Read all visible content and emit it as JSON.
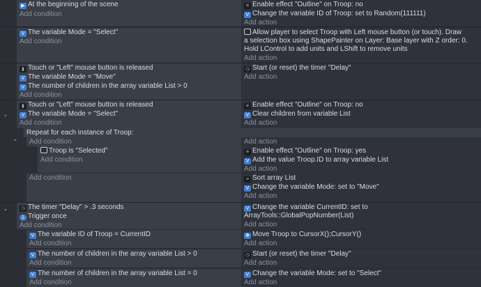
{
  "events": [
    {
      "conditions": [
        "At the beginning of the scene"
      ],
      "add_condition": "Add condition",
      "actions": [
        "Enable effect \"Outline\" on Troop: no",
        "Change the variable ID of Troop: set to Random(111111)"
      ],
      "add_action": "Add action"
    },
    {
      "conditions": [
        "The variable Mode = \"Select\""
      ],
      "add_condition": "Add condition",
      "actions": [
        "Allow player to select Troop with Left mouse button (or touch). Draw",
        "a selection box using ShapePainter on Layer: Base layer with Z order: 0.",
        "Hold LControl to add units and LShift to remove units"
      ],
      "add_action": "Add action"
    },
    {
      "conditions": [
        "Touch or \"Left\" mouse button is released",
        "The variable Mode = \"Move\"",
        "The number of children in the array variable List > 0"
      ],
      "add_condition": "Add condition",
      "actions": [
        "Start (or reset) the timer \"Delay\""
      ],
      "add_action": "Add action"
    },
    {
      "conditions": [
        "Touch or \"Left\" mouse button is released",
        "The variable Mode = \"Select\""
      ],
      "add_condition": "Add condition",
      "actions": [
        "Enable effect \"Outline\" on Troop: no",
        "Clear children from variable List"
      ],
      "add_action": "Add action"
    }
  ],
  "repeat": {
    "header": "Repeat for each instance of Troop:",
    "add_condition": "Add condition",
    "add_action": "Add action",
    "sub1": {
      "conditions": [
        "Troop is \"Selected\""
      ],
      "add_condition": "Add condition",
      "actions": [
        "Enable effect \"Outline\" on Troop: yes",
        "Add the value Troop.ID to array variable List"
      ],
      "add_action": "Add action"
    },
    "sub2": {
      "add_condition": "Add condition",
      "actions": [
        "Sort array List",
        "Change the variable Mode: set to \"Move\""
      ],
      "add_action": "Add action"
    }
  },
  "timer_event": {
    "conditions": [
      "The timer \"Delay\" > .3 seconds",
      "Trigger once"
    ],
    "add_condition": "Add condition",
    "actions": [
      "Change the variable CurrentID: set to",
      "ArrayTools::GlobalPopNumber(List)"
    ],
    "add_action": "Add action",
    "subs": [
      {
        "conditions": [
          "The variable ID of Troop = CurrentID"
        ],
        "add_condition": "Add condition",
        "actions": [
          "Move Troop to CursorX();CursorY()"
        ],
        "add_action": "Add action"
      },
      {
        "conditions": [
          "The number of children in the array variable List > 0"
        ],
        "add_condition": "Add condition",
        "actions": [
          "Start (or reset) the timer \"Delay\""
        ],
        "add_action": "Add action"
      },
      {
        "conditions": [
          "The number of children in the array variable List = 0"
        ],
        "add_condition": "Add condition",
        "actions": [
          "Change the variable Mode: set to \"Select\""
        ],
        "add_action": "Add action"
      }
    ]
  }
}
